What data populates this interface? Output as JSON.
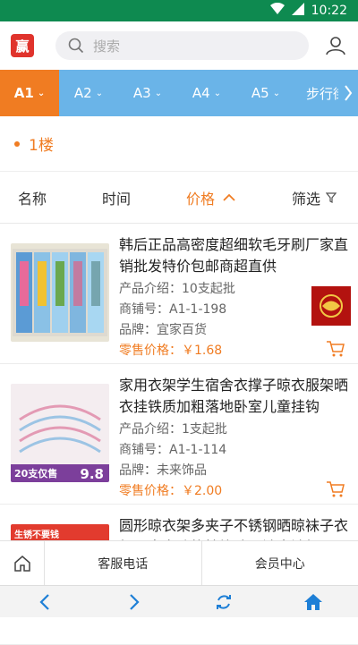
{
  "status_bar": {
    "time": "10:22"
  },
  "header": {
    "logo_text": "赢",
    "search_placeholder": "搜索"
  },
  "tabs": [
    {
      "label": "A1",
      "active": true
    },
    {
      "label": "A2",
      "active": false
    },
    {
      "label": "A3",
      "active": false
    },
    {
      "label": "A4",
      "active": false
    },
    {
      "label": "A5",
      "active": false
    },
    {
      "label": "步行街",
      "active": false
    }
  ],
  "floor": {
    "label": "1楼"
  },
  "sort": {
    "name": "名称",
    "time": "时间",
    "price": "价格",
    "filter": "筛选"
  },
  "products": [
    {
      "title": "韩后正品高密度超细软毛牙刷厂家直销批发特价包邮商超直供",
      "intro": "产品介绍：10支起批",
      "shop": "商铺号：A1-1-198",
      "brand": "品牌：宜家百货",
      "price": "零售价格：￥1.68",
      "thumb_color": "#6fa8d6"
    },
    {
      "title": "家用衣架学生宿舍衣撑子晾衣服架晒衣挂铁质加粗落地卧室儿童挂钩",
      "intro": "产品介绍：1支起批",
      "shop": "商铺号：A1-1-114",
      "brand": "品牌：未来饰品",
      "price": "零售价格：￥2.00",
      "thumb_badge": "20支仅售",
      "thumb_price": "9.8"
    },
    {
      "title": "圆形晾衣架多夹子不锈钢晒晾袜子衣架儿童多功能挂钩防风袜夹袜架",
      "thumb_badge": "生锈不要钱"
    }
  ],
  "bottom_nav": {
    "phone": "客服电话",
    "member": "会员中心"
  },
  "colors": {
    "accent": "#f07c22",
    "tab_bg": "#6ab4e8",
    "status": "#0e8a50"
  }
}
